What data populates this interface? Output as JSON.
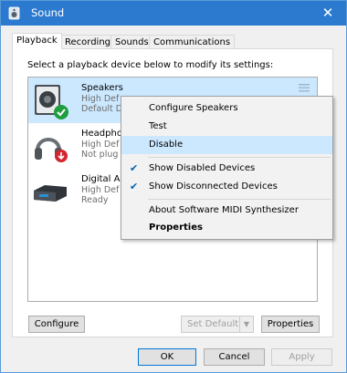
{
  "window": {
    "title": "Sound",
    "close_glyph": "✕"
  },
  "tabs": [
    {
      "label": "Playback",
      "active": true
    },
    {
      "label": "Recording",
      "active": false
    },
    {
      "label": "Sounds",
      "active": false
    },
    {
      "label": "Communications",
      "active": false
    }
  ],
  "instruction": "Select a playback device below to modify its settings:",
  "devices": [
    {
      "name": "Speakers",
      "line1": "High Def",
      "line2": "Default D",
      "icon": "speaker-icon",
      "status_icon": "check-badge-icon",
      "selected": true
    },
    {
      "name": "Headpho",
      "line1": "High Def",
      "line2": "Not plug",
      "icon": "headphones-icon",
      "status_icon": "unplugged-badge-icon",
      "selected": false
    },
    {
      "name": "Digital Au",
      "line1": "High Def",
      "line2": "Ready",
      "icon": "digital-audio-icon",
      "status_icon": "",
      "selected": false
    }
  ],
  "buttons": {
    "configure": "Configure",
    "set_default": "Set Default",
    "properties": "Properties",
    "ok": "OK",
    "cancel": "Cancel",
    "apply": "Apply"
  },
  "context_menu": {
    "items": [
      {
        "label": "Configure Speakers",
        "checked": false,
        "bold": false,
        "highlight": false
      },
      {
        "label": "Test",
        "checked": false,
        "bold": false,
        "highlight": false
      },
      {
        "label": "Disable",
        "checked": false,
        "bold": false,
        "highlight": true
      },
      {
        "label": "Show Disabled Devices",
        "checked": true,
        "bold": false,
        "highlight": false
      },
      {
        "label": "Show Disconnected Devices",
        "checked": true,
        "bold": false,
        "highlight": false
      },
      {
        "label": "About Software MIDI Synthesizer",
        "checked": false,
        "bold": false,
        "highlight": false
      },
      {
        "label": "Properties",
        "checked": false,
        "bold": true,
        "highlight": false
      }
    ],
    "check_glyph": "✔"
  },
  "colors": {
    "titlebar": "#2b7ad0",
    "selection": "#cce8ff",
    "check_badge": "#1e9e3e",
    "unplugged_badge": "#d3262f"
  }
}
